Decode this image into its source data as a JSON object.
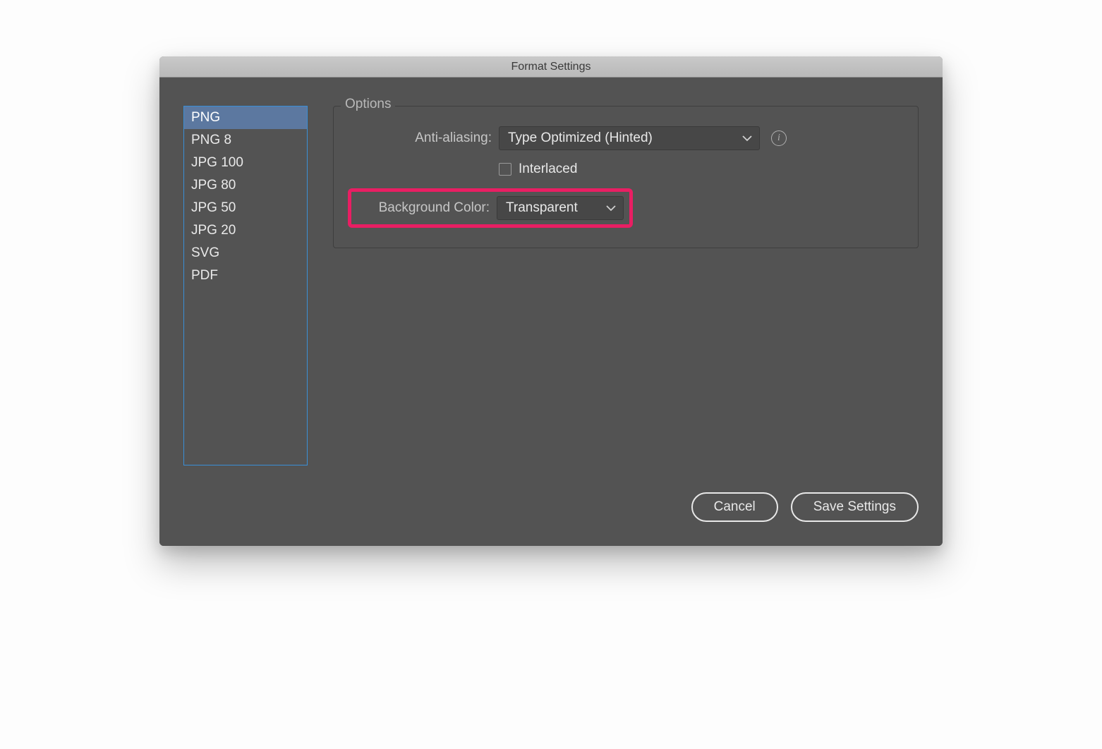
{
  "titlebar": {
    "title": "Format Settings"
  },
  "sidebar": {
    "items": [
      "PNG",
      "PNG 8",
      "JPG 100",
      "JPG 80",
      "JPG 50",
      "JPG 20",
      "SVG",
      "PDF"
    ],
    "selected_index": 0
  },
  "options": {
    "legend": "Options",
    "anti_aliasing": {
      "label": "Anti-aliasing:",
      "value": "Type Optimized (Hinted)"
    },
    "interlaced": {
      "label": "Interlaced",
      "checked": false
    },
    "background_color": {
      "label": "Background Color:",
      "value": "Transparent"
    }
  },
  "buttons": {
    "cancel": "Cancel",
    "save": "Save Settings"
  }
}
